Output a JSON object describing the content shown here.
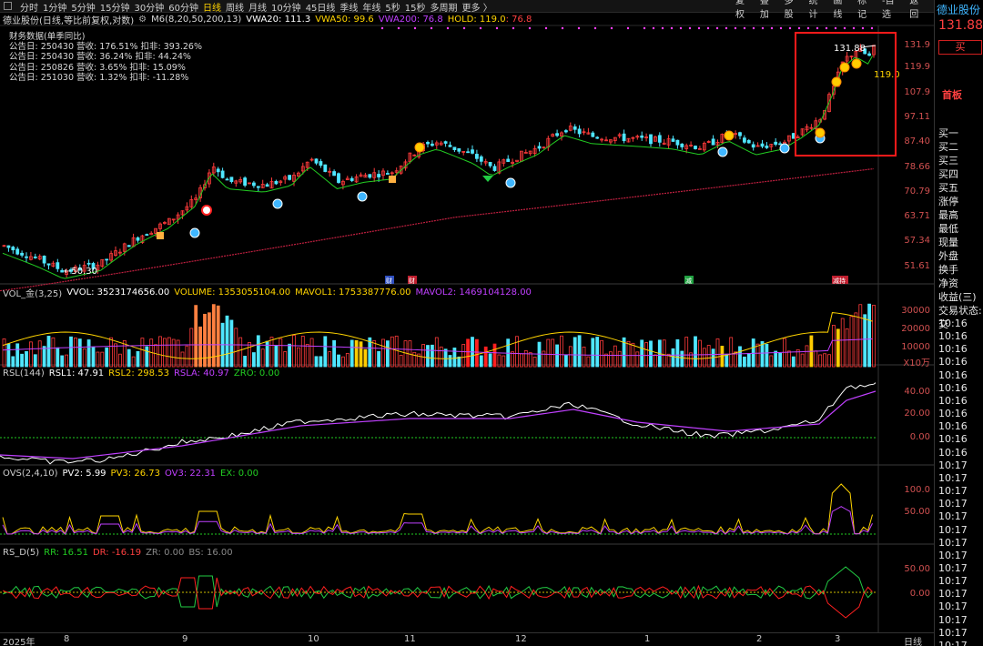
{
  "toolbar": {
    "periods": [
      "分时",
      "1分钟",
      "5分钟",
      "15分钟",
      "30分钟",
      "60分钟",
      "日线",
      "周线",
      "月线",
      "10分钟",
      "45日线",
      "季线",
      "年线",
      "5秒",
      "15秒",
      "多周期",
      "更多 〉"
    ],
    "active_period": "日线",
    "tools": [
      "复权",
      "叠加",
      "多股",
      "统计",
      "画线",
      "标记",
      "-自选",
      "返回"
    ]
  },
  "main_chart": {
    "stock_title": "德业股份(日线,等比前复权,对数)",
    "indicator_name": "M6(8,20,50,200,13)",
    "vwa20": "VWA20: 111.3",
    "vwa50": "VWA50: 99.6",
    "vwa200": "VWA200: 76.8",
    "hold": "HOLD: 119.0",
    "hold_diff": ": 76.8",
    "financial_title": "财务数据(单季同比)",
    "financial_rows": [
      "公告日: 250430  营收: 176.51%  扣非: 393.26%",
      "公告日: 250430  营收: 36.24%  扣非: 44.24%",
      "公告日: 250826  营收: 3.65%  扣非: 15.09%",
      "公告日: 251030  营收: 1.32%  扣非: -11.28%"
    ],
    "price_axis": [
      "131.9",
      "119.9",
      "107.9",
      "97.11",
      "87.40",
      "78.66",
      "70.79",
      "63.71",
      "57.34",
      "51.61"
    ],
    "high_label": "131.88",
    "hold_label": "119.0",
    "low_label": "50.30",
    "event_tags": [
      "财",
      "财",
      "减",
      "减持"
    ]
  },
  "vol_panel": {
    "name": "VOL_金(3,25)",
    "vvol": "VVOL: 3523174656.00",
    "volume": "VOLUME: 1353055104.00",
    "mavol1": "MAVOL1: 1753387776.00",
    "mavol2": "MAVOL2: 1469104128.00",
    "axis": [
      "30000",
      "20000",
      "10000"
    ],
    "unit": "X10万"
  },
  "rsl_panel": {
    "name": "RSL(144)",
    "rsl1": "RSL1: 47.91",
    "rsl2": "RSL2: 298.53",
    "rsla": "RSLA: 40.97",
    "zro": "ZRO: 0.00",
    "axis": [
      "40.00",
      "20.00",
      "0.00"
    ]
  },
  "ovs_panel": {
    "name": "OVS(2,4,10)",
    "pv2": "PV2: 5.99",
    "pv3": "PV3: 26.73",
    "ov3": "OV3: 22.31",
    "ex": "EX: 0.00",
    "axis": [
      "100.0",
      "50.00"
    ]
  },
  "rsd_panel": {
    "name": "RS_D(5)",
    "rr": "RR: 16.51",
    "dr": "DR: -16.19",
    "zr": "ZR: 0.00",
    "bs": "BS: 16.00",
    "axis": [
      "50.00",
      "0.00"
    ]
  },
  "x_axis": [
    "2025年",
    "8",
    "9",
    "10",
    "11",
    "12",
    "1",
    "2",
    "3"
  ],
  "x_axis_right": "日线",
  "right_panel": {
    "stock_name": "德业股份",
    "price": "131.88",
    "buy_label": "买",
    "first_board": "首板",
    "quote_rows": [
      "买一",
      "买二",
      "买三",
      "买四",
      "买五",
      "涨停",
      "最高",
      "最低",
      "现量",
      "外盘",
      "换手",
      "净资",
      "收益(三)",
      "交易状态: 交"
    ],
    "times": [
      "10:16",
      "10:16",
      "10:16",
      "10:16",
      "10:16",
      "10:16",
      "10:16",
      "10:16",
      "10:16",
      "10:16",
      "10:16",
      "10:17",
      "10:17",
      "10:17",
      "10:17",
      "10:17",
      "10:17",
      "10:17",
      "10:17",
      "10:17",
      "10:17",
      "10:17",
      "10:17",
      "10:17",
      "10:17",
      "10:17"
    ]
  },
  "colors": {
    "up": "#ff3b3b",
    "down": "#4fe6ff",
    "vwa20": "#ffffff",
    "vwa50": "#ffd400",
    "vwa200": "#c040ff",
    "hold": "#ffd400",
    "support": "#22cc22"
  }
}
